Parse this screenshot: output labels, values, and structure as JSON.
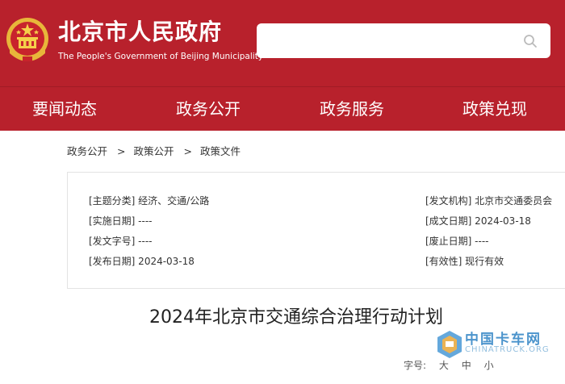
{
  "header": {
    "title": "北京市人民政府",
    "subtitle": "The People's Government of Beijing Municipality",
    "search_placeholder": "",
    "brand_color": "#b8212c"
  },
  "nav": {
    "items": [
      {
        "label": "要闻动态"
      },
      {
        "label": "政务公开"
      },
      {
        "label": "政务服务"
      },
      {
        "label": "政策兑现"
      }
    ]
  },
  "breadcrumb": {
    "items": [
      "政务公开",
      "政策公开",
      "政策文件"
    ],
    "separator": ">"
  },
  "meta": {
    "left": [
      {
        "text": "[主题分类] 经济、交通/公路"
      },
      {
        "text": "[实施日期] ----"
      },
      {
        "text": "[发文字号] ----"
      },
      {
        "text": "[发布日期] 2024-03-18"
      }
    ],
    "right": [
      {
        "text": "[发文机构] 北京市交通委员会"
      },
      {
        "text": "[成文日期] 2024-03-18"
      },
      {
        "text": "[废止日期] ----"
      },
      {
        "text": "[有效性] 现行有效"
      }
    ]
  },
  "document": {
    "title": "2024年北京市交通综合治理行动计划"
  },
  "font_size": {
    "label": "字号:",
    "options": [
      "大",
      "中",
      "小"
    ]
  },
  "watermark": {
    "cn": "中国卡车网",
    "en": "CHINATRUCK.ORG"
  }
}
